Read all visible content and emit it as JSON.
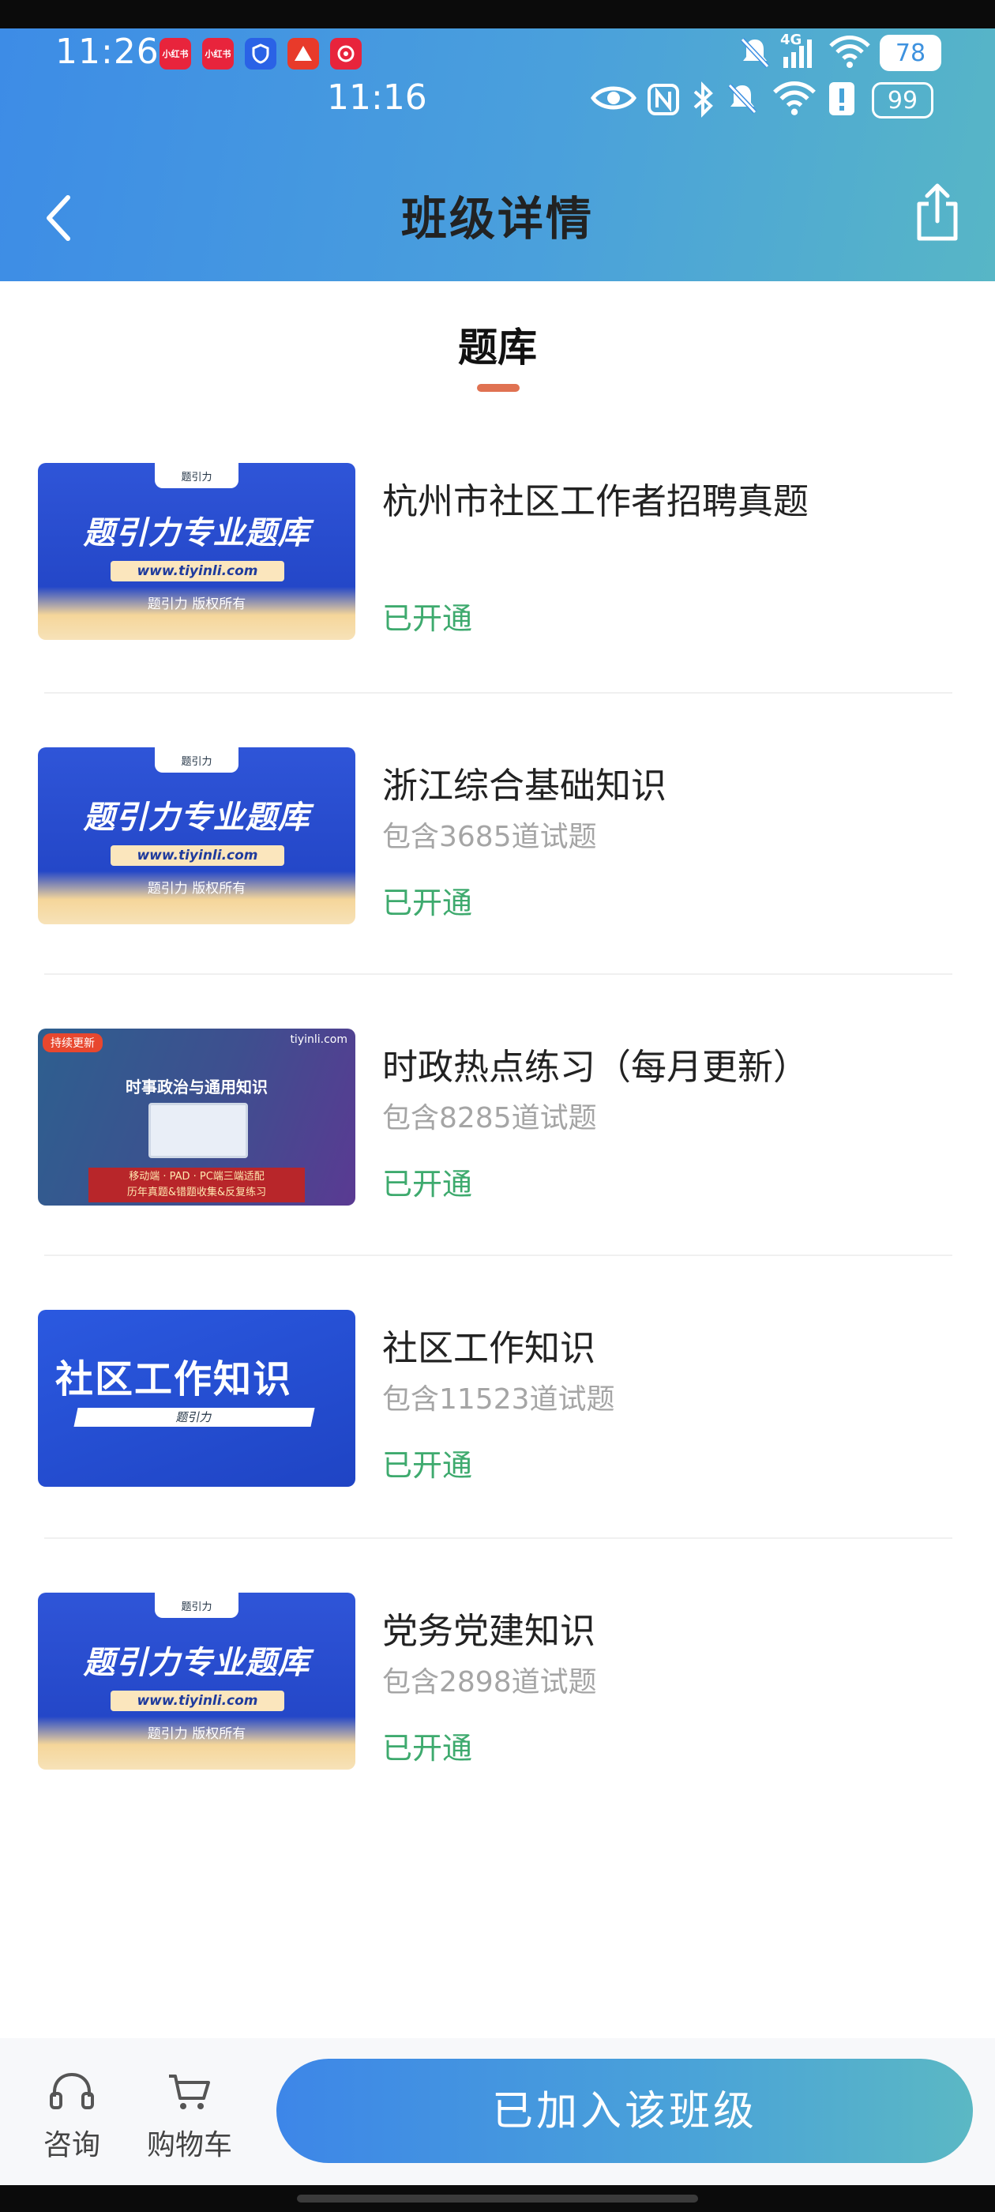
{
  "status_bar": {
    "time_primary": "11:26",
    "time_secondary": "11:16",
    "battery_primary": "78",
    "battery_secondary": "99",
    "network": "4G",
    "app_icons": [
      {
        "name": "xiaohongshu-icon",
        "label": "小红书",
        "color": "#e8243c"
      },
      {
        "name": "xiaohongshu-icon",
        "label": "小红书",
        "color": "#e8243c"
      },
      {
        "name": "shield-app-icon",
        "label": "",
        "color": "#2a62e6"
      },
      {
        "name": "bank-app-icon",
        "label": "",
        "color": "#e83a2a"
      },
      {
        "name": "meituan-app-icon",
        "label": "",
        "color": "#e8243c"
      }
    ]
  },
  "header": {
    "title": "班级详情",
    "back_icon": "chevron-left-icon",
    "share_icon": "share-icon"
  },
  "tab": {
    "label": "题库",
    "indicator_color": "#e07252"
  },
  "items": [
    {
      "title": "杭州市社区工作者招聘真题",
      "count": "",
      "status": "已开通",
      "thumb": {
        "main": "题引力专业题库",
        "url": "www.tiyinli.com",
        "copyright": "题引力 版权所有",
        "logo": "题引力"
      }
    },
    {
      "title": "浙江综合基础知识",
      "count": "包含3685道试题",
      "status": "已开通",
      "thumb": {
        "main": "题引力专业题库",
        "url": "www.tiyinli.com",
        "copyright": "题引力 版权所有",
        "logo": "题引力"
      }
    },
    {
      "title": "时政热点练习（每月更新）",
      "count": "包含8285道试题",
      "status": "已开通",
      "thumb": {
        "badge": "持续更新",
        "site": "tiyinli.com",
        "sub": "时事政治与通用知识",
        "line1": "移动端 · PAD · PC端三端适配",
        "line2": "历年真题&错题收集&反复练习"
      }
    },
    {
      "title": "社区工作知识",
      "count": "包含11523道试题",
      "status": "已开通",
      "thumb": {
        "main": "社区工作知识",
        "bar": "题引力"
      }
    },
    {
      "title": "党务党建知识",
      "count": "包含2898道试题",
      "status": "已开通",
      "thumb": {
        "main": "题引力专业题库",
        "url": "www.tiyinli.com",
        "copyright": "题引力 版权所有",
        "logo": "题引力"
      }
    }
  ],
  "bottom_bar": {
    "consult_label": "咨询",
    "consult_icon": "headset-icon",
    "cart_label": "购物车",
    "cart_icon": "shopping-cart-icon",
    "join_label": "已加入该班级"
  },
  "colors": {
    "accent_blue": "#3d8ce6",
    "status_green": "#3eaa6e",
    "count_gray": "#a5a5a5"
  }
}
